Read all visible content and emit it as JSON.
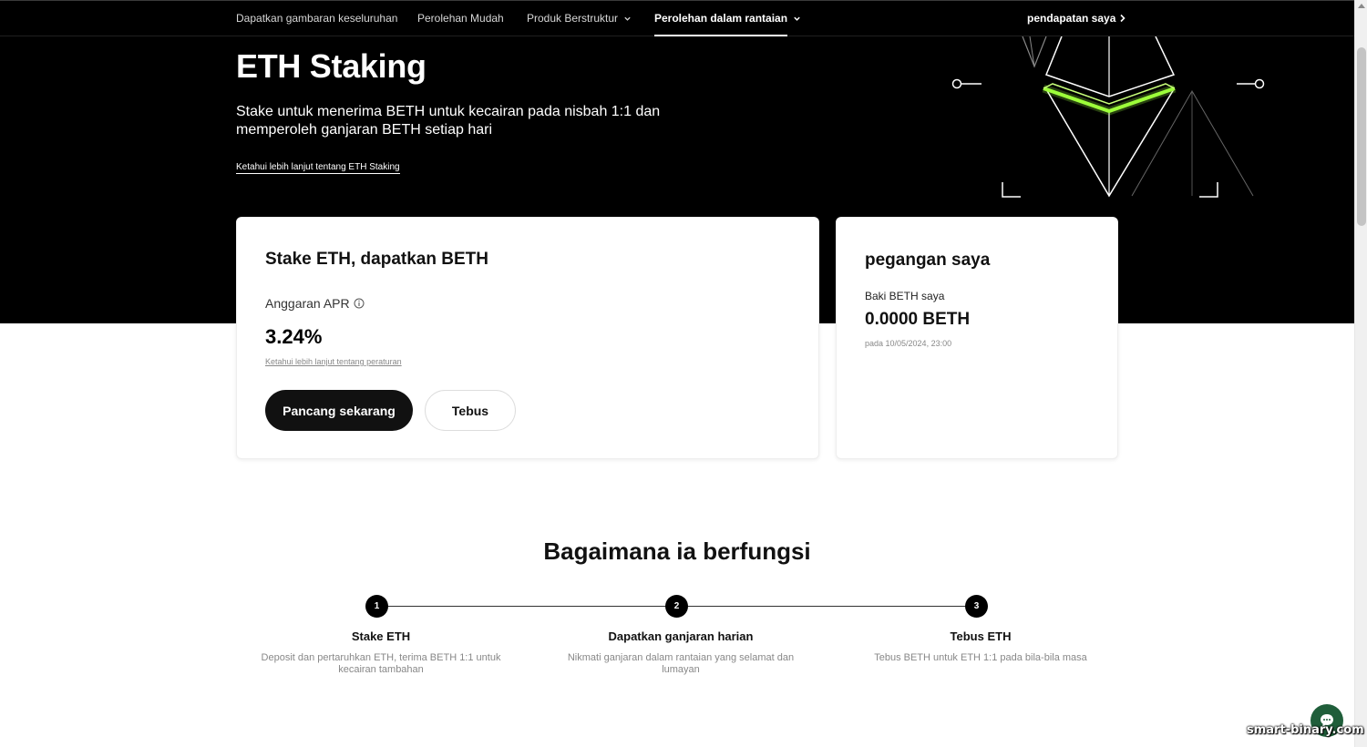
{
  "nav": {
    "items": [
      {
        "label": "Dapatkan gambaran keseluruhan"
      },
      {
        "label": "Perolehan Mudah"
      },
      {
        "label": "Produk Berstruktur"
      },
      {
        "label": "Perolehan dalam rantaian"
      }
    ],
    "right_label": "pendapatan saya"
  },
  "hero": {
    "title": "ETH Staking",
    "subtitle": "Stake untuk menerima BETH untuk kecairan pada nisbah 1:1 dan memperoleh ganjaran BETH setiap hari",
    "link": "Ketahui lebih lanjut tentang ETH Staking"
  },
  "stake_card": {
    "title": "Stake ETH, dapatkan BETH",
    "apr_label": "Anggaran APR",
    "apr_value": "3.24%",
    "rules_link": "Ketahui lebih lanjut tentang peraturan",
    "primary_button": "Pancang sekarang",
    "secondary_button": "Tebus"
  },
  "holdings_card": {
    "title": "pegangan saya",
    "balance_label": "Baki BETH saya",
    "balance_value": "0.0000 BETH",
    "timestamp": "pada 10/05/2024, 23:00"
  },
  "how": {
    "title": "Bagaimana ia berfungsi",
    "steps": [
      {
        "num": "1",
        "title": "Stake ETH",
        "desc": "Deposit dan pertaruhkan ETH, terima BETH 1:1 untuk kecairan tambahan"
      },
      {
        "num": "2",
        "title": "Dapatkan ganjaran harian",
        "desc": "Nikmati ganjaran dalam rantaian yang selamat dan lumayan"
      },
      {
        "num": "3",
        "title": "Tebus ETH",
        "desc": "Tebus BETH untuk ETH 1:1 pada bila-bila masa"
      }
    ]
  },
  "watermark": "smart-binary.com",
  "colors": {
    "hero_bg": "#000000",
    "accent_green": "#9dff3a",
    "primary_button": "#111111",
    "chat_button": "#1f5e3a"
  }
}
